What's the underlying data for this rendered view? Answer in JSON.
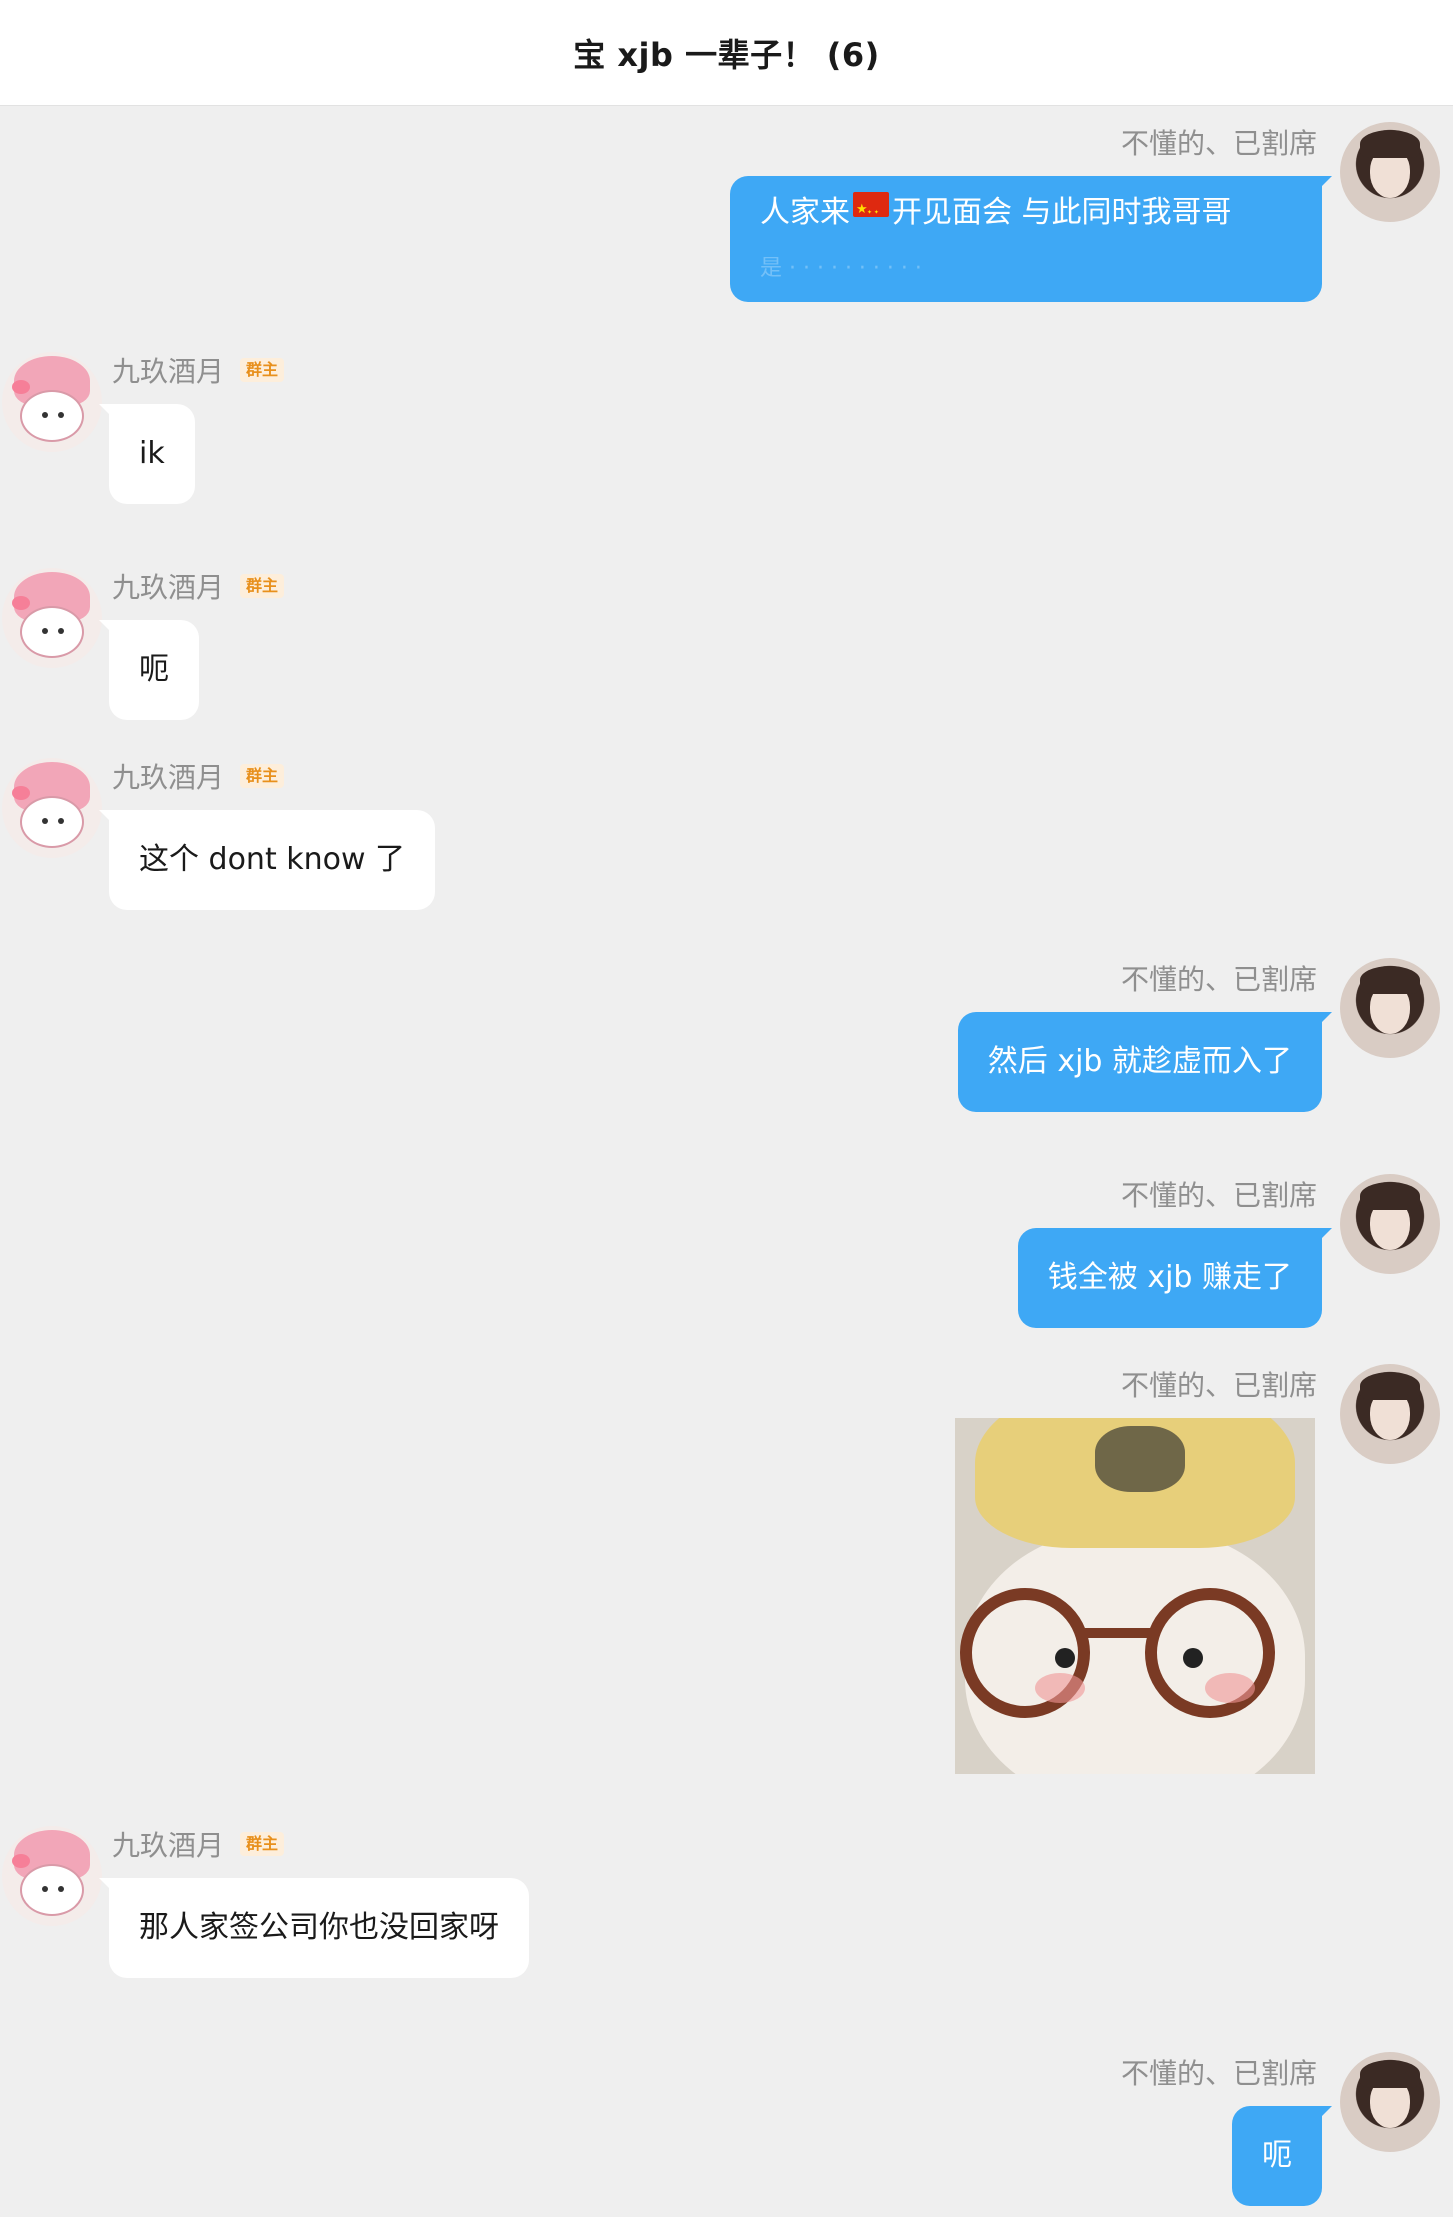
{
  "header": {
    "title": "宝 xjb 一辈子！ (6)"
  },
  "me": {
    "name": "不懂的、已割席"
  },
  "them": {
    "name": "九玖酒月",
    "badge": "群主"
  },
  "messages": [
    {
      "sender": "me",
      "text_before": "人家来",
      "flag": "china-flag-icon",
      "text_after": "开见面会 与此同时我哥哥",
      "faded": "是 · · · · · · · · · ·"
    },
    {
      "sender": "them",
      "text": "ik"
    },
    {
      "sender": "them",
      "text": "呃"
    },
    {
      "sender": "them",
      "text": "这个 dont know 了"
    },
    {
      "sender": "me",
      "text": "然后 xjb 就趁虚而入了"
    },
    {
      "sender": "me",
      "text": "钱全被 xjb 赚走了"
    },
    {
      "sender": "me",
      "type": "sticker",
      "sticker": "plush-doll-with-glasses-sticker"
    },
    {
      "sender": "them",
      "text": "那人家签公司你也没回家呀"
    },
    {
      "sender": "me",
      "text": "呃"
    }
  ],
  "colors": {
    "my_bubble": "#3ea8f5",
    "their_bubble": "#ffffff",
    "background": "#efefef",
    "badge": "#e8901c"
  }
}
